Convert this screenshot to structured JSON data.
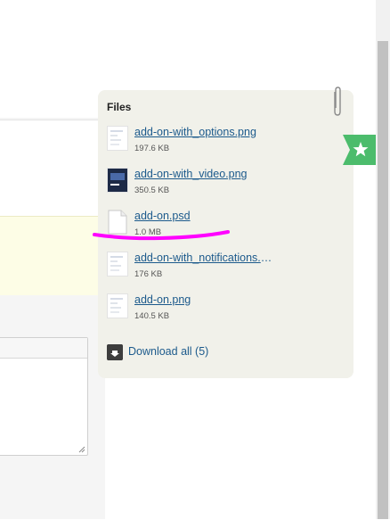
{
  "files_panel": {
    "title": "Files",
    "items": [
      {
        "name": "add-on-with_options.png",
        "size": "197.6 KB",
        "thumb": "image"
      },
      {
        "name": "add-on-with_video.png",
        "size": "350.5 KB",
        "thumb": "video"
      },
      {
        "name": "add-on.psd",
        "size": "1.0 MB",
        "thumb": "document"
      },
      {
        "name": "add-on-with_notifications.png",
        "size": "176 KB",
        "thumb": "image"
      },
      {
        "name": "add-on.png",
        "size": "140.5 KB",
        "thumb": "image"
      }
    ],
    "download_all": "Download all (5)"
  },
  "colors": {
    "link": "#1c5a8c",
    "panel_bg": "#f1f1ea",
    "star_tab": "#4cbc6c",
    "annotation": "#ff00ff"
  },
  "icons": {
    "paperclip": "paperclip-icon",
    "star": "star-icon",
    "download": "download-icon",
    "document": "document-icon"
  }
}
